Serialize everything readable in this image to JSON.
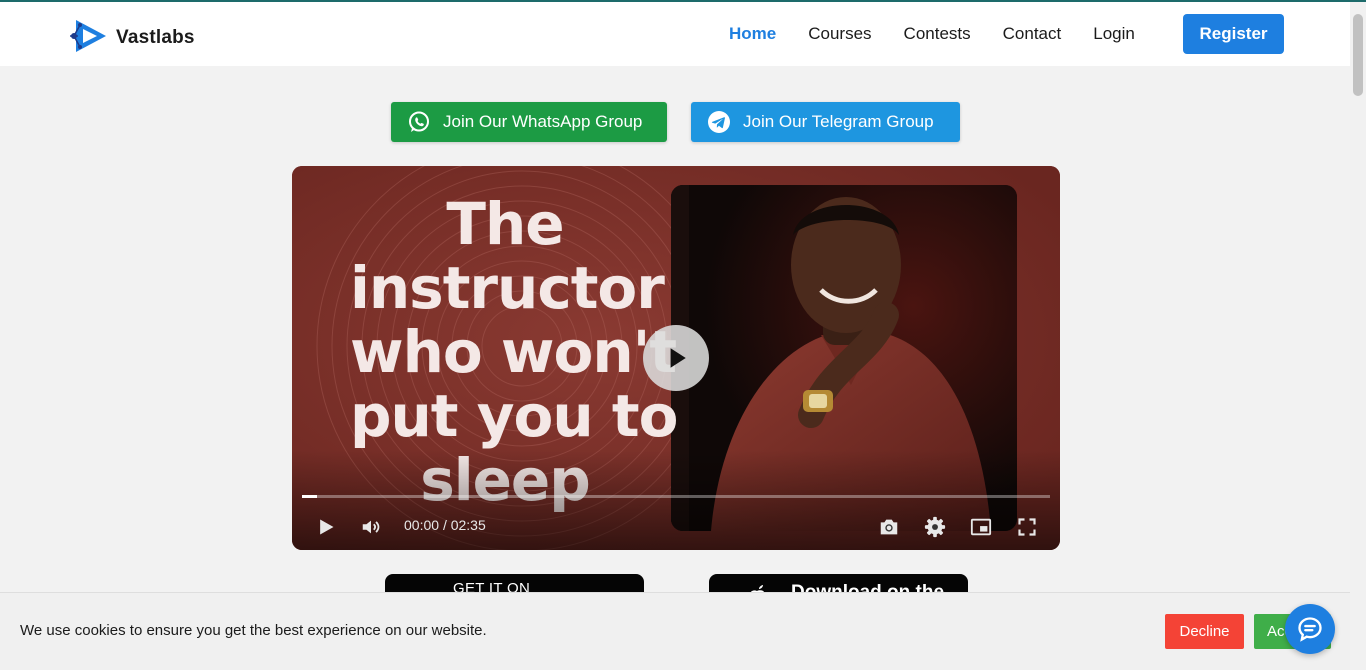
{
  "brand": {
    "name": "Vastlabs",
    "logo_icon": "vastlabs-logo-icon"
  },
  "nav": {
    "items": [
      {
        "label": "Home",
        "active": true
      },
      {
        "label": "Courses",
        "active": false
      },
      {
        "label": "Contests",
        "active": false
      },
      {
        "label": "Contact",
        "active": false
      },
      {
        "label": "Login",
        "active": false
      }
    ],
    "register_label": "Register"
  },
  "community": {
    "whatsapp": {
      "label": "Join Our WhatsApp Group",
      "icon": "whatsapp-icon",
      "color": "#1c9b44"
    },
    "telegram": {
      "label": "Join Our Telegram Group",
      "icon": "telegram-icon",
      "color": "#1e96e0"
    }
  },
  "video": {
    "headline_lines": [
      "The",
      "instructor",
      "who won't",
      "put you to",
      "sleep"
    ],
    "current_time": "00:00",
    "separator": "/",
    "duration": "02:35",
    "progress": 0.02,
    "controls": [
      "play-icon",
      "volume-icon",
      "camera-icon",
      "settings-icon",
      "picture-in-picture-icon",
      "fullscreen-icon"
    ]
  },
  "store_badges": {
    "google_play_caption": "GET IT ON",
    "app_store_caption": "Download on the"
  },
  "cookie": {
    "message": "We use cookies to ensure you get the best experience on our website.",
    "decline_label": "Decline",
    "accept_label": "Accept"
  },
  "colors": {
    "primary": "#1e7fe0",
    "decline": "#f44336",
    "accept": "#3fae49"
  }
}
